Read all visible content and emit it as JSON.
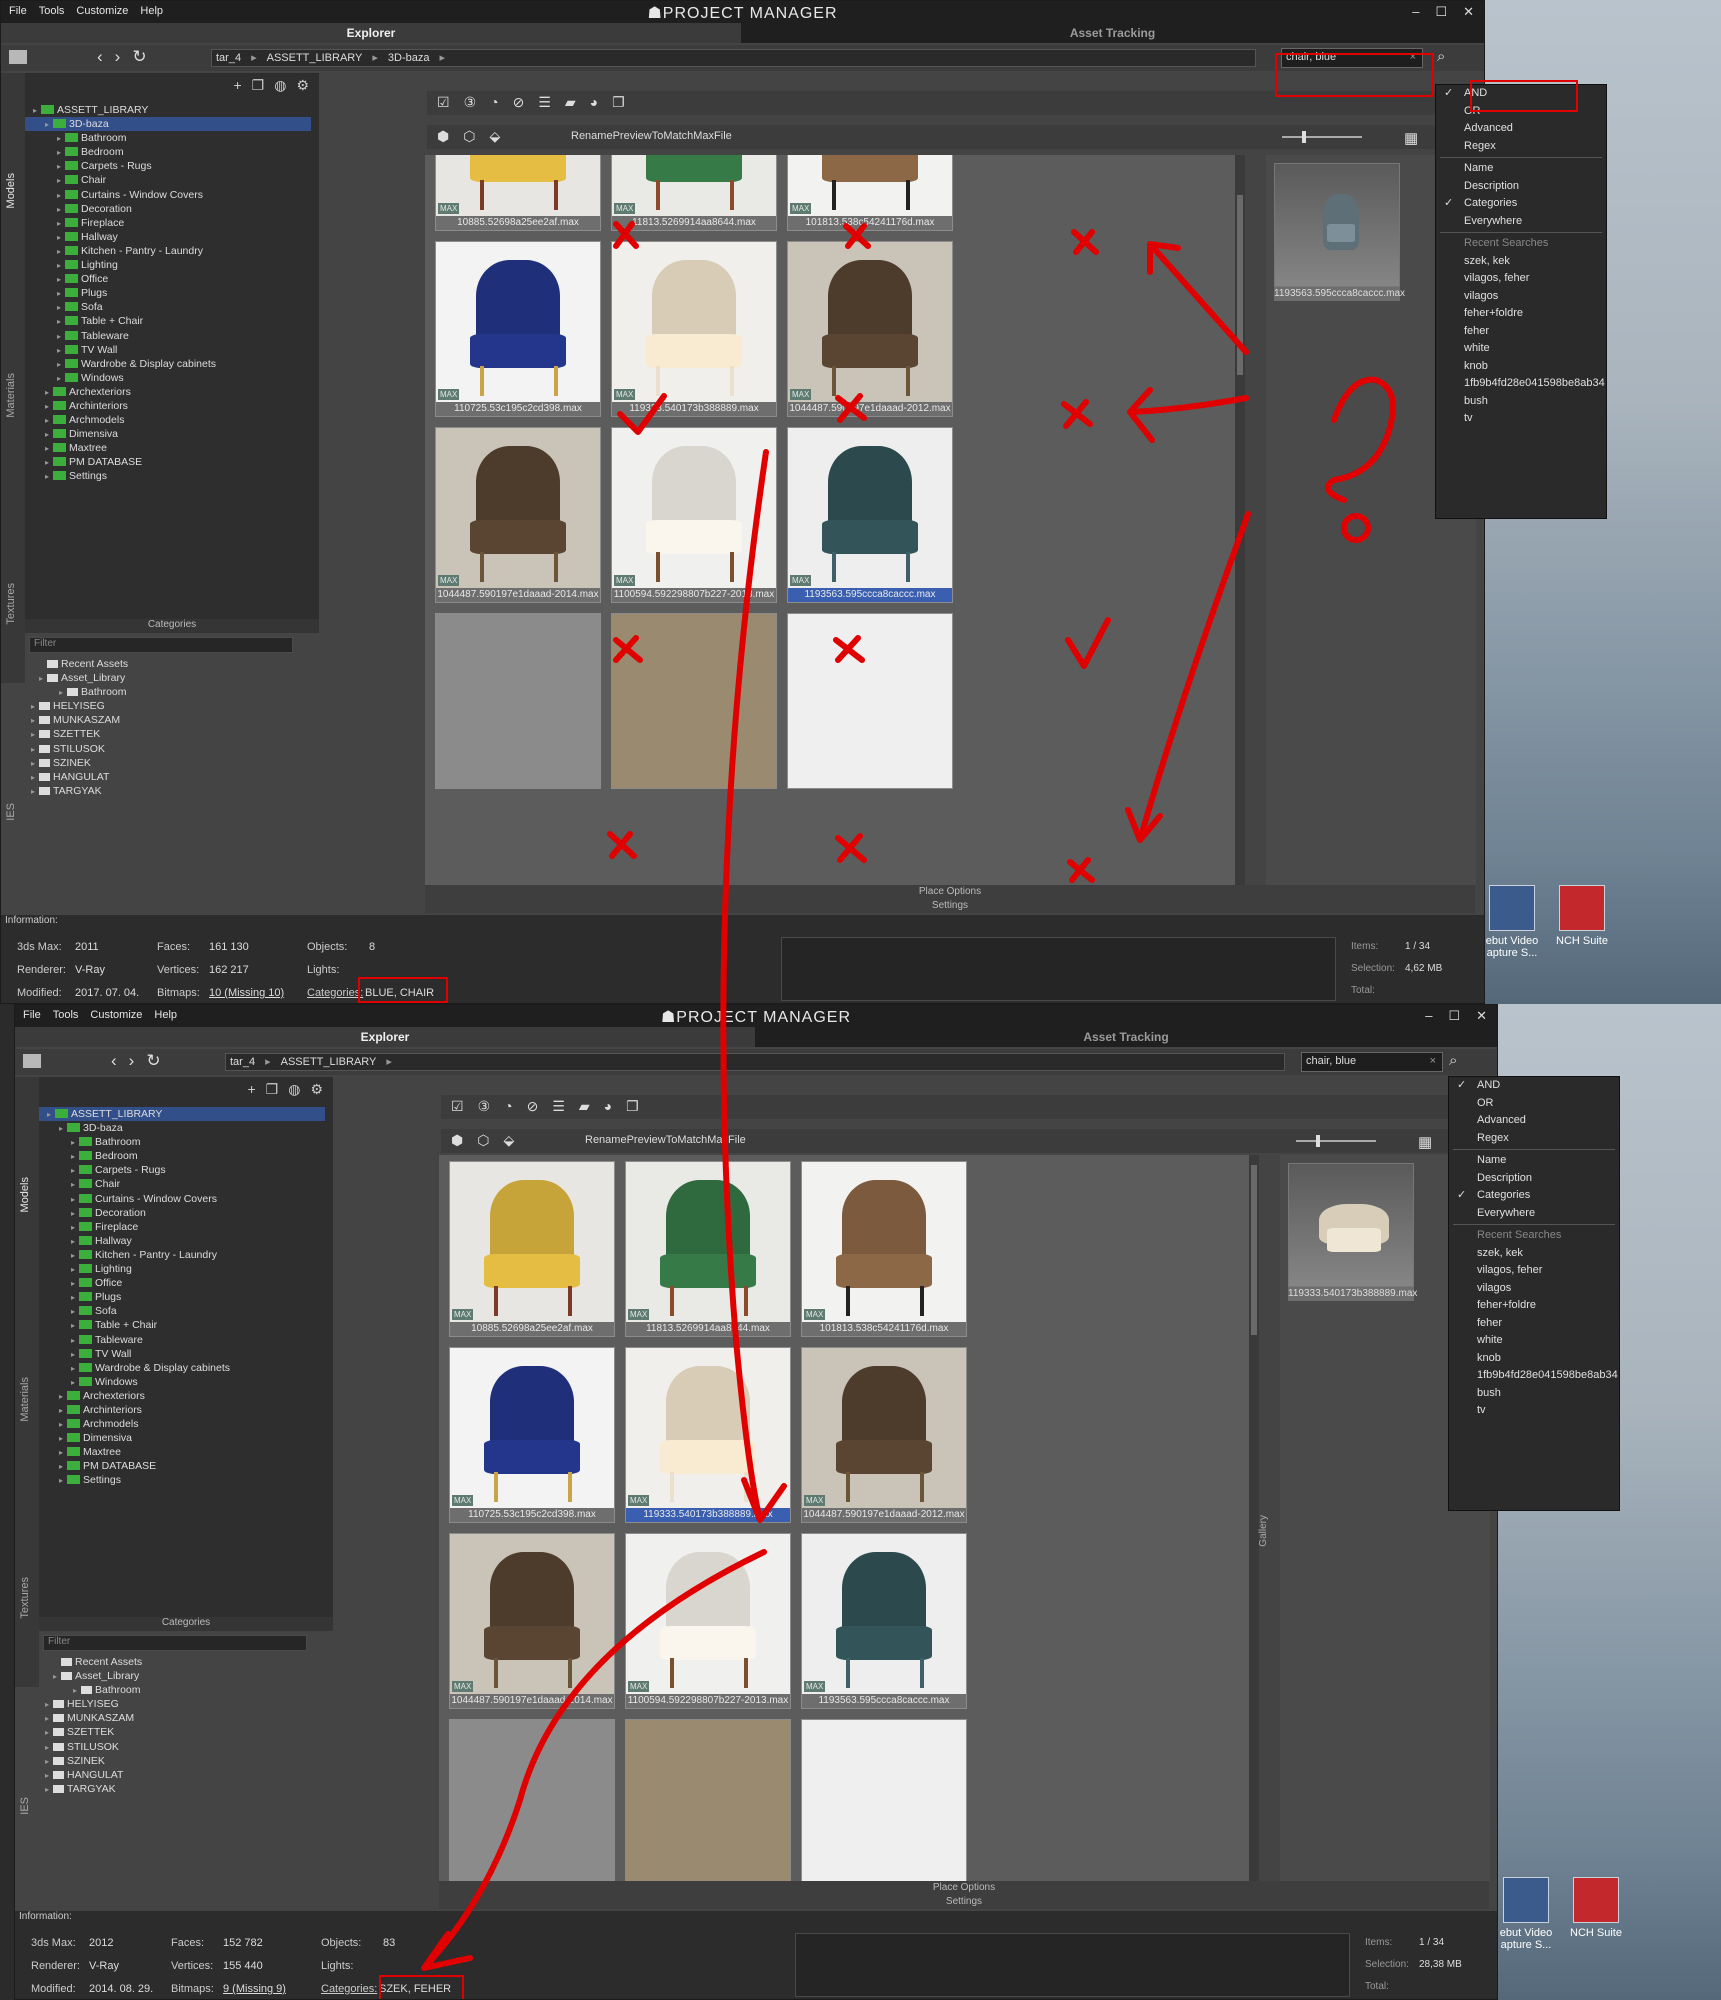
{
  "menu": [
    "File",
    "Tools",
    "Customize",
    "Help"
  ],
  "app_title": "PROJECT MANAGER",
  "tabs": {
    "explorer": "Explorer",
    "asset_tracking": "Asset Tracking"
  },
  "toolbar": {
    "rename_label": "RenamePreviewToMatchMaxFile"
  },
  "search": {
    "value": "chair, blue",
    "clear": "×"
  },
  "side_tabs": [
    "Models",
    "Materials",
    "Textures",
    "IES"
  ],
  "categories_header": "Categories",
  "filter_placeholder": "Filter",
  "tree_children": [
    "Bathroom",
    "Bedroom",
    "Carpets - Rugs",
    "Chair",
    "Curtains - Window Covers",
    "Decoration",
    "Fireplace",
    "Hallway",
    "Kitchen - Pantry - Laundry",
    "Lighting",
    "Office",
    "Plugs",
    "Sofa",
    "Table + Chair",
    "Tableware",
    "TV Wall",
    "Wardrobe & Display cabinets",
    "Windows"
  ],
  "tree_roots": [
    "Archexteriors",
    "Archinteriors",
    "Archmodels",
    "Dimensiva",
    "Maxtree",
    "PM DATABASE",
    "Settings"
  ],
  "tree_root": "ASSETT_LIBRARY",
  "tree_node": "3D-baza",
  "cat_tree": [
    "Recent Assets",
    "Asset_Library",
    "Bathroom",
    "HELYISEG",
    "MUNKASZAM",
    "SZETTEK",
    "STILUSOK",
    "SZINEK",
    "HANGULAT",
    "TARGYAK"
  ],
  "dropdown": {
    "modes": [
      "AND",
      "OR",
      "Advanced",
      "Regex"
    ],
    "fields": [
      "Name",
      "Description",
      "Categories",
      "Everywhere"
    ],
    "recent_header": "Recent Searches",
    "recent": [
      "szek, kek",
      "vilagos, feher",
      "vilagos",
      "feher+foldre",
      "feher",
      "white",
      "knob",
      "1fb9b4fd28e041598be8ab34",
      "bush",
      "tv"
    ]
  },
  "place_options": "Place Options",
  "settings_label": "Settings",
  "info_label": "Information:",
  "info_keys": {
    "max": "3ds Max:",
    "renderer": "Renderer:",
    "modified": "Modified:",
    "faces": "Faces:",
    "vertices": "Vertices:",
    "bitmaps": "Bitmaps:",
    "objects": "Objects:",
    "lights": "Lights:",
    "categories": "Categories:",
    "items": "Items:",
    "selection": "Selection:",
    "total": "Total:"
  },
  "gallery_label": "Gallery",
  "desktop_icons": [
    "ebut Video apture S...",
    "NCH Suite"
  ],
  "max_badge": "MAX",
  "top": {
    "breadcrumb": [
      "tar_4",
      "ASSETT_LIBRARY",
      "3D-baza"
    ],
    "preview_caption": "1193563.595ccca8caccc.max",
    "captions": [
      "10885.52698a25ee2af.max",
      "11813.5269914aa8644.max",
      "101813.538c54241176d.max",
      "110725.53c195c2cd398.max",
      "119333.54‍0173b388889.max",
      "1044487.590197e1daaad-2012.max",
      "1044487.590197e1daaad-2014.max",
      "1100594.592298807b227-2013.max",
      "1193563.595ccca8caccc.max"
    ],
    "info": {
      "max": "2011",
      "renderer": "V-Ray",
      "modified": "2017. 07. 04.",
      "faces": "161 130",
      "vertices": "162 217",
      "bitmaps": "10 (Missing 10)",
      "objects": "8",
      "categories": "BLUE, CHAIR",
      "items": "1 / 34",
      "selection": "4,62 MB"
    }
  },
  "bottom": {
    "breadcrumb": [
      "tar_4",
      "ASSETT_LIBRARY"
    ],
    "preview_caption": "119333.540173b388889.max",
    "captions": [
      "10885.52698a25ee2af.max",
      "11813.5269914aa8644.max",
      "101813.538c54241176d.max",
      "110725.53c195c2cd398.max",
      "119333.540173b388889.max",
      "1044487.590197e1daaad-2012.max",
      "1044487.590197e1daaad-2014.max",
      "1100594.592298807b227-2013.max",
      "1193563.595ccca8caccc.max"
    ],
    "info": {
      "max": "2012",
      "renderer": "V-Ray",
      "modified": "2014. 08. 29.",
      "faces": "152 782",
      "vertices": "155 440",
      "bitmaps": "9 (Missing 9)",
      "objects": "83",
      "categories": "SZEK, FEHER",
      "items": "1 / 34",
      "selection": "28,38 MB"
    }
  },
  "colors": {
    "annotation": "#e10000",
    "selection": "#3a5fb0",
    "folder": "#3cae3c"
  }
}
